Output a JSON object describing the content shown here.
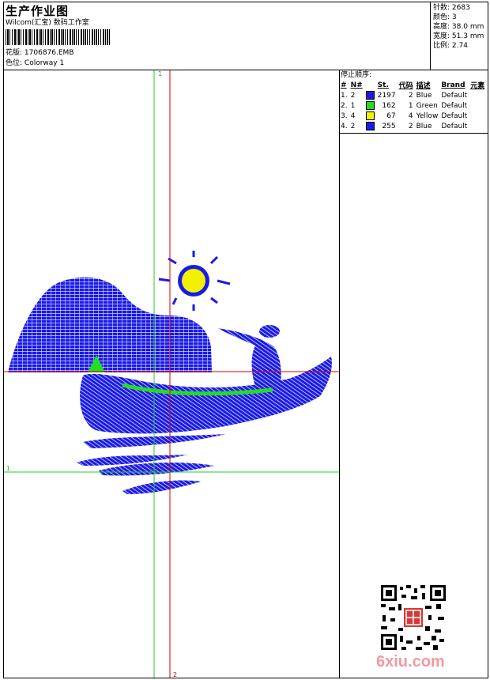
{
  "header": {
    "title": "生产作业图",
    "studio": "Wilcom(汇宝) 数码工作室",
    "design_label": "花版:",
    "design_value": "1706876.EMB",
    "colorway_label": "色位:",
    "colorway_value": "Colorway 1"
  },
  "stats": [
    {
      "label": "针数:",
      "value": "2683"
    },
    {
      "label": "颜色:",
      "value": "3"
    },
    {
      "label": "高度:",
      "value": "38.0 mm"
    },
    {
      "label": "宽度:",
      "value": "51.3 mm"
    },
    {
      "label": "比例:",
      "value": "2.74"
    }
  ],
  "sequence": {
    "title": "停止顺序:",
    "headers": [
      "#",
      "N#",
      "St.",
      "代码",
      "描述",
      "Brand",
      "元素"
    ],
    "rows": [
      {
        "idx": "1.",
        "n": "2",
        "color": "#1a1ae6",
        "st": "2197",
        "code": "2",
        "desc": "Blue",
        "brand": "Default"
      },
      {
        "idx": "2.",
        "n": "1",
        "color": "#22dd22",
        "st": "162",
        "code": "1",
        "desc": "Green",
        "brand": "Default"
      },
      {
        "idx": "3.",
        "n": "4",
        "color": "#f2f200",
        "st": "67",
        "code": "4",
        "desc": "Yellow",
        "brand": "Default"
      },
      {
        "idx": "4.",
        "n": "2",
        "color": "#1a1ae6",
        "st": "255",
        "code": "2",
        "desc": "Blue",
        "brand": "Default"
      }
    ]
  },
  "guides": {
    "green_v": "1",
    "green_h": "1",
    "red_v": "2"
  },
  "colors": {
    "blue": "#1a1ae6",
    "green": "#22dd22",
    "yellow": "#f2f200",
    "guide_green": "#22cc22",
    "guide_red": "#dd0000"
  },
  "watermark": "6xiu.com"
}
